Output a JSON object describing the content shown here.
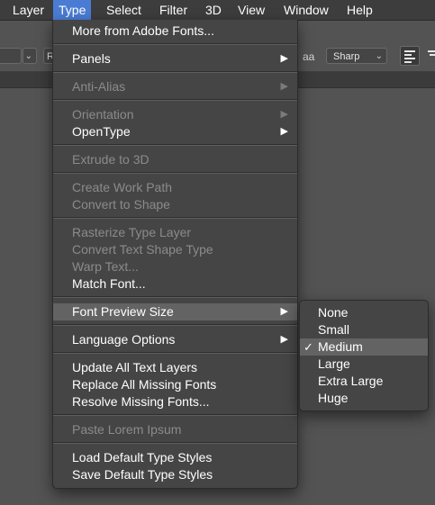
{
  "menubar": {
    "items": [
      "Layer",
      "Type",
      "Select",
      "Filter",
      "3D",
      "View",
      "Window",
      "Help"
    ],
    "active": "Type"
  },
  "options": {
    "anti_alias_icon": "aa",
    "anti_alias_value": "Sharp",
    "partial_left": "R"
  },
  "type_menu": {
    "items": [
      {
        "label": "More from Adobe Fonts...",
        "enabled": true,
        "submenu": false
      },
      {
        "label": "Panels",
        "enabled": true,
        "submenu": true
      },
      {
        "label": "Anti-Alias",
        "enabled": false,
        "submenu": true
      },
      {
        "label": "Orientation",
        "enabled": false,
        "submenu": true
      },
      {
        "label": "OpenType",
        "enabled": true,
        "submenu": true
      },
      {
        "label": "Extrude to 3D",
        "enabled": false,
        "submenu": false
      },
      {
        "label": "Create Work Path",
        "enabled": false,
        "submenu": false
      },
      {
        "label": "Convert to Shape",
        "enabled": false,
        "submenu": false
      },
      {
        "label": "Rasterize Type Layer",
        "enabled": false,
        "submenu": false
      },
      {
        "label": "Convert Text Shape Type",
        "enabled": false,
        "submenu": false
      },
      {
        "label": "Warp Text...",
        "enabled": false,
        "submenu": false
      },
      {
        "label": "Match Font...",
        "enabled": true,
        "submenu": false
      },
      {
        "label": "Font Preview Size",
        "enabled": true,
        "submenu": true,
        "highlighted": true
      },
      {
        "label": "Language Options",
        "enabled": true,
        "submenu": true
      },
      {
        "label": "Update All Text Layers",
        "enabled": true,
        "submenu": false
      },
      {
        "label": "Replace All Missing Fonts",
        "enabled": true,
        "submenu": false
      },
      {
        "label": "Resolve Missing Fonts...",
        "enabled": true,
        "submenu": false
      },
      {
        "label": "Paste Lorem Ipsum",
        "enabled": false,
        "submenu": false
      },
      {
        "label": "Load Default Type Styles",
        "enabled": true,
        "submenu": false
      },
      {
        "label": "Save Default Type Styles",
        "enabled": true,
        "submenu": false
      }
    ]
  },
  "font_preview_submenu": {
    "items": [
      "None",
      "Small",
      "Medium",
      "Large",
      "Extra Large",
      "Huge"
    ],
    "selected": "Medium",
    "check_glyph": "✓"
  },
  "glyphs": {
    "submenu_arrow": "▶",
    "chevron_down": "⌄"
  }
}
